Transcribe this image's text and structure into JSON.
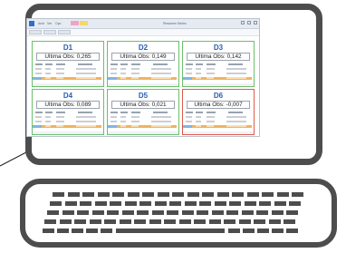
{
  "app": {
    "window_title": "Resumen Series"
  },
  "menu": {
    "items": [
      "Arch",
      "Ver",
      "Opc",
      "Ayuda"
    ]
  },
  "tiles": [
    {
      "id": "D1",
      "obs_label": "Ultima Obs:",
      "obs_value": "0,265",
      "status": "ok"
    },
    {
      "id": "D2",
      "obs_label": "Ultima Obs:",
      "obs_value": "0,149",
      "status": "ok"
    },
    {
      "id": "D3",
      "obs_label": "Ultima Obs:",
      "obs_value": "0,142",
      "status": "ok"
    },
    {
      "id": "D4",
      "obs_label": "Ultima Obs:",
      "obs_value": "0,089",
      "status": "ok"
    },
    {
      "id": "D5",
      "obs_label": "Ultima Obs:",
      "obs_value": "0,021",
      "status": "ok"
    },
    {
      "id": "D6",
      "obs_label": "Ultima Obs:",
      "obs_value": "-0,007",
      "status": "alert"
    }
  ],
  "colors": {
    "ok_border": "#6cc06c",
    "alert_border": "#e05a4a",
    "title_blue": "#2a5db0",
    "highlight_blue": "#7fb5e6",
    "highlight_orange": "#f2b35a",
    "device_outline": "#4d4d4d"
  }
}
